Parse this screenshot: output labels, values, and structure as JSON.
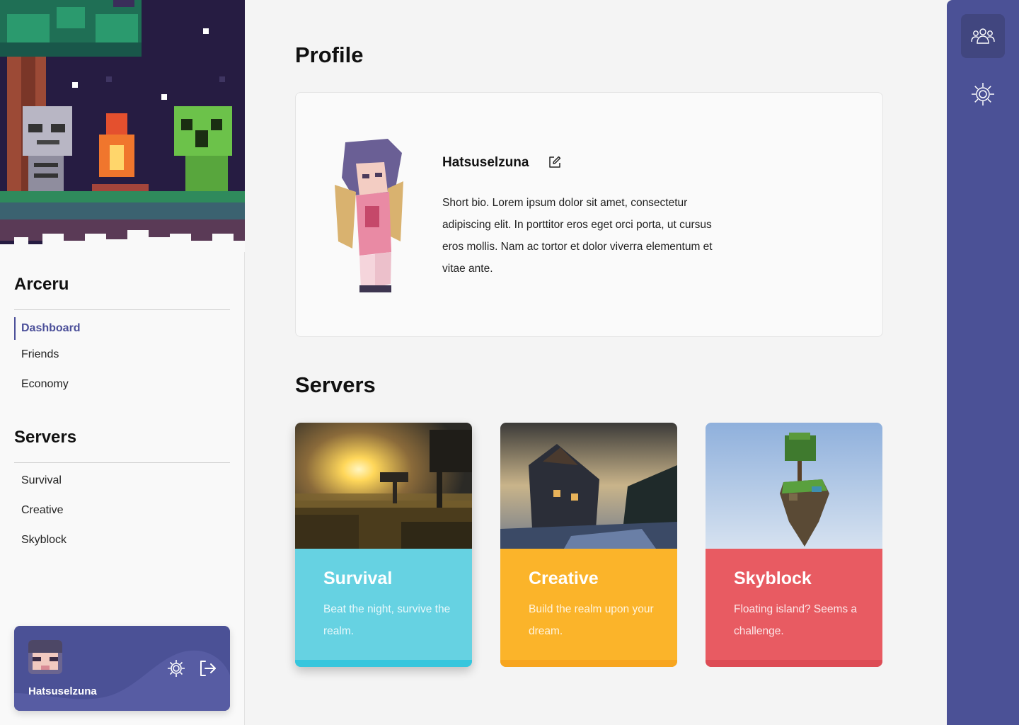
{
  "sidebar": {
    "brand": "Arceru",
    "main_nav": [
      {
        "label": "Dashboard",
        "active": true
      },
      {
        "label": "Friends",
        "active": false
      },
      {
        "label": "Economy",
        "active": false
      }
    ],
    "servers_title": "Servers",
    "servers_nav": [
      {
        "label": "Survival"
      },
      {
        "label": "Creative"
      },
      {
        "label": "Skyblock"
      }
    ],
    "user": {
      "name": "Hatsuselzuna"
    }
  },
  "main": {
    "profile_title": "Profile",
    "profile": {
      "name": "Hatsuselzuna",
      "bio": "Short bio. Lorem ipsum dolor sit amet, consectetur adipiscing elit. In porttitor eros eget orci porta, ut cursus eros mollis. Nam ac tortor et dolor viverra elementum et vitae ante."
    },
    "servers_title": "Servers",
    "servers": [
      {
        "name": "Survival",
        "description": "Beat the night, survive the realm.",
        "color": "#66d2e2",
        "bar": "#36c6dd"
      },
      {
        "name": "Creative",
        "description": "Build the realm upon your dream.",
        "color": "#fbb42a",
        "bar": "#f7a51f"
      },
      {
        "name": "Skyblock",
        "description": "Floating island? Seems a challenge.",
        "color": "#e85b62",
        "bar": "#dd4c55"
      }
    ]
  },
  "rail": {
    "items": [
      {
        "icon": "users-icon",
        "active": true
      },
      {
        "icon": "gear-icon",
        "active": false
      }
    ]
  },
  "colors": {
    "accent": "#4b5196",
    "accent_text": "#4b4f99",
    "background": "#f4f4f4"
  }
}
